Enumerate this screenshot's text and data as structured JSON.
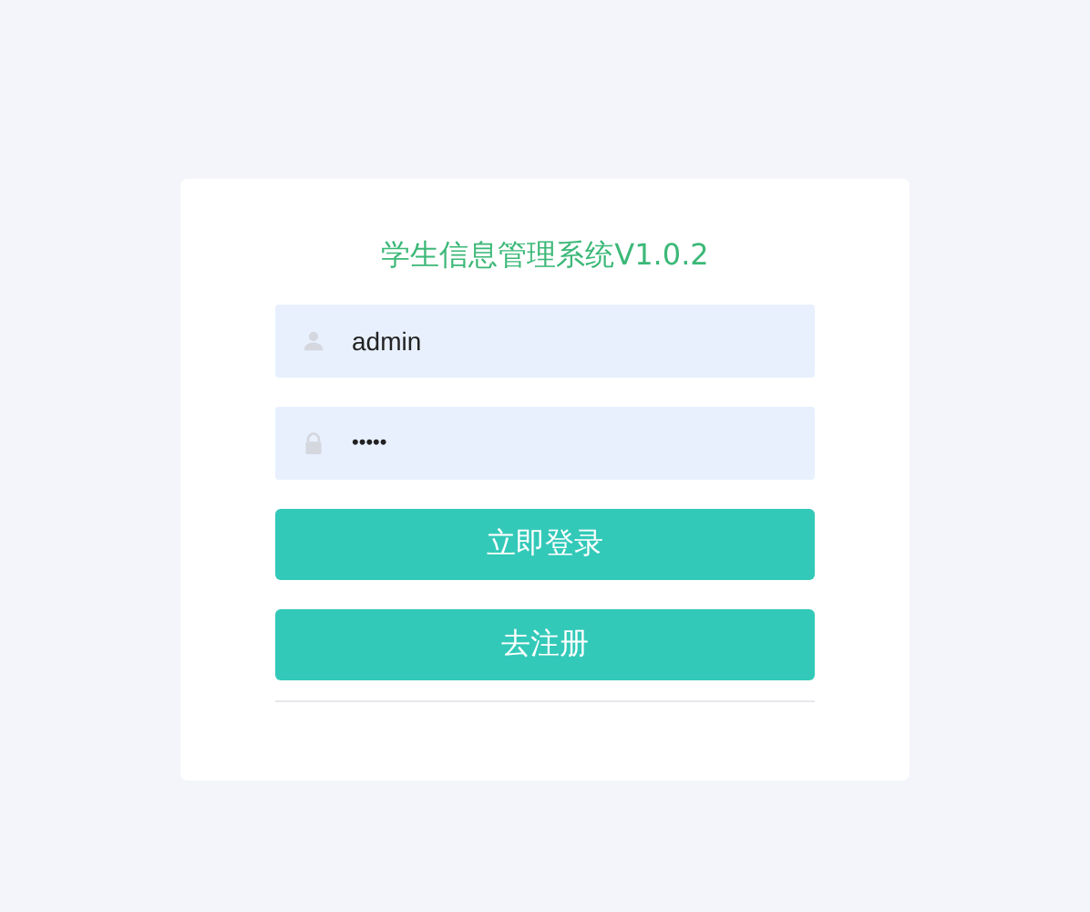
{
  "title": "学生信息管理系统V1.0.2",
  "fields": [
    {
      "kind": "user",
      "value": "admin"
    },
    {
      "kind": "lock",
      "value": "•••••"
    }
  ],
  "buttons": [
    "立即登录",
    "去注册"
  ]
}
